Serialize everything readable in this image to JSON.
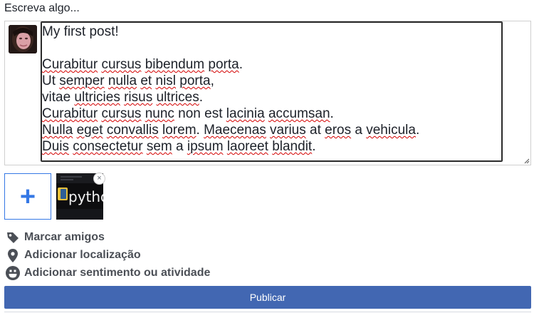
{
  "composer": {
    "prompt": "Escreva algo...",
    "text_lines": [
      [
        {
          "t": "My first post!",
          "s": false
        }
      ],
      [],
      [
        {
          "t": "Curabitur",
          "s": true
        },
        {
          "t": " ",
          "s": false
        },
        {
          "t": "cursus",
          "s": true
        },
        {
          "t": " ",
          "s": false
        },
        {
          "t": "bibendum",
          "s": true
        },
        {
          "t": " ",
          "s": false
        },
        {
          "t": "porta",
          "s": true
        },
        {
          "t": ".",
          "s": false
        }
      ],
      [
        {
          "t": "Ut ",
          "s": false
        },
        {
          "t": "semper",
          "s": true
        },
        {
          "t": " ",
          "s": false
        },
        {
          "t": "nulla",
          "s": true
        },
        {
          "t": " ",
          "s": false
        },
        {
          "t": "et",
          "s": true
        },
        {
          "t": " ",
          "s": false
        },
        {
          "t": "nisl",
          "s": true
        },
        {
          "t": " ",
          "s": false
        },
        {
          "t": "porta",
          "s": true
        },
        {
          "t": ",",
          "s": false
        }
      ],
      [
        {
          "t": "vitae ",
          "s": false
        },
        {
          "t": "ultricies",
          "s": true
        },
        {
          "t": " ",
          "s": false
        },
        {
          "t": "risus",
          "s": true
        },
        {
          "t": " ",
          "s": false
        },
        {
          "t": "ultrices",
          "s": true
        },
        {
          "t": ".",
          "s": false
        }
      ],
      [
        {
          "t": "Curabitur",
          "s": true
        },
        {
          "t": " ",
          "s": false
        },
        {
          "t": "cursus",
          "s": true
        },
        {
          "t": " ",
          "s": false
        },
        {
          "t": "nunc",
          "s": true
        },
        {
          "t": " non est ",
          "s": false
        },
        {
          "t": "lacinia",
          "s": true
        },
        {
          "t": " ",
          "s": false
        },
        {
          "t": "accumsan",
          "s": true
        },
        {
          "t": ".",
          "s": false
        }
      ],
      [
        {
          "t": "Nulla",
          "s": true
        },
        {
          "t": " ",
          "s": false
        },
        {
          "t": "eget",
          "s": true
        },
        {
          "t": " ",
          "s": false
        },
        {
          "t": "convallis",
          "s": true
        },
        {
          "t": " ",
          "s": false
        },
        {
          "t": "lorem",
          "s": true
        },
        {
          "t": ". ",
          "s": false
        },
        {
          "t": "Maecenas",
          "s": true
        },
        {
          "t": " ",
          "s": false
        },
        {
          "t": "varius",
          "s": true
        },
        {
          "t": " at ",
          "s": false
        },
        {
          "t": "eros",
          "s": true
        },
        {
          "t": " a ",
          "s": false
        },
        {
          "t": "vehicula",
          "s": true
        },
        {
          "t": ".",
          "s": false
        }
      ],
      [
        {
          "t": "Duis",
          "s": true
        },
        {
          "t": " ",
          "s": false
        },
        {
          "t": "consectetur",
          "s": true
        },
        {
          "t": " ",
          "s": false
        },
        {
          "t": "sem",
          "s": true
        },
        {
          "t": " a ",
          "s": false
        },
        {
          "t": "ipsum",
          "s": true
        },
        {
          "t": " ",
          "s": false
        },
        {
          "t": "laoreet",
          "s": true
        },
        {
          "t": " ",
          "s": false
        },
        {
          "t": "blandit",
          "s": true
        },
        {
          "t": ".",
          "s": false
        }
      ]
    ]
  },
  "media": {
    "add_icon": "plus-icon",
    "add_symbol": "+",
    "thumbnail_text": "pytho",
    "remove_icon": "close-icon",
    "remove_symbol": "×"
  },
  "actions": [
    {
      "id": "tag-friends",
      "icon": "tag-icon",
      "label": "Marcar amigos"
    },
    {
      "id": "add-location",
      "icon": "location-pin-icon",
      "label": "Adicionar localização"
    },
    {
      "id": "add-feeling",
      "icon": "smiley-icon",
      "label": "Adicionar sentimento ou atividade"
    }
  ],
  "publish_label": "Publicar",
  "colors": {
    "primary": "#4267b2",
    "accent": "#3578e5",
    "action_icon": "#4b4f56",
    "spellcheck": "#d40000"
  }
}
